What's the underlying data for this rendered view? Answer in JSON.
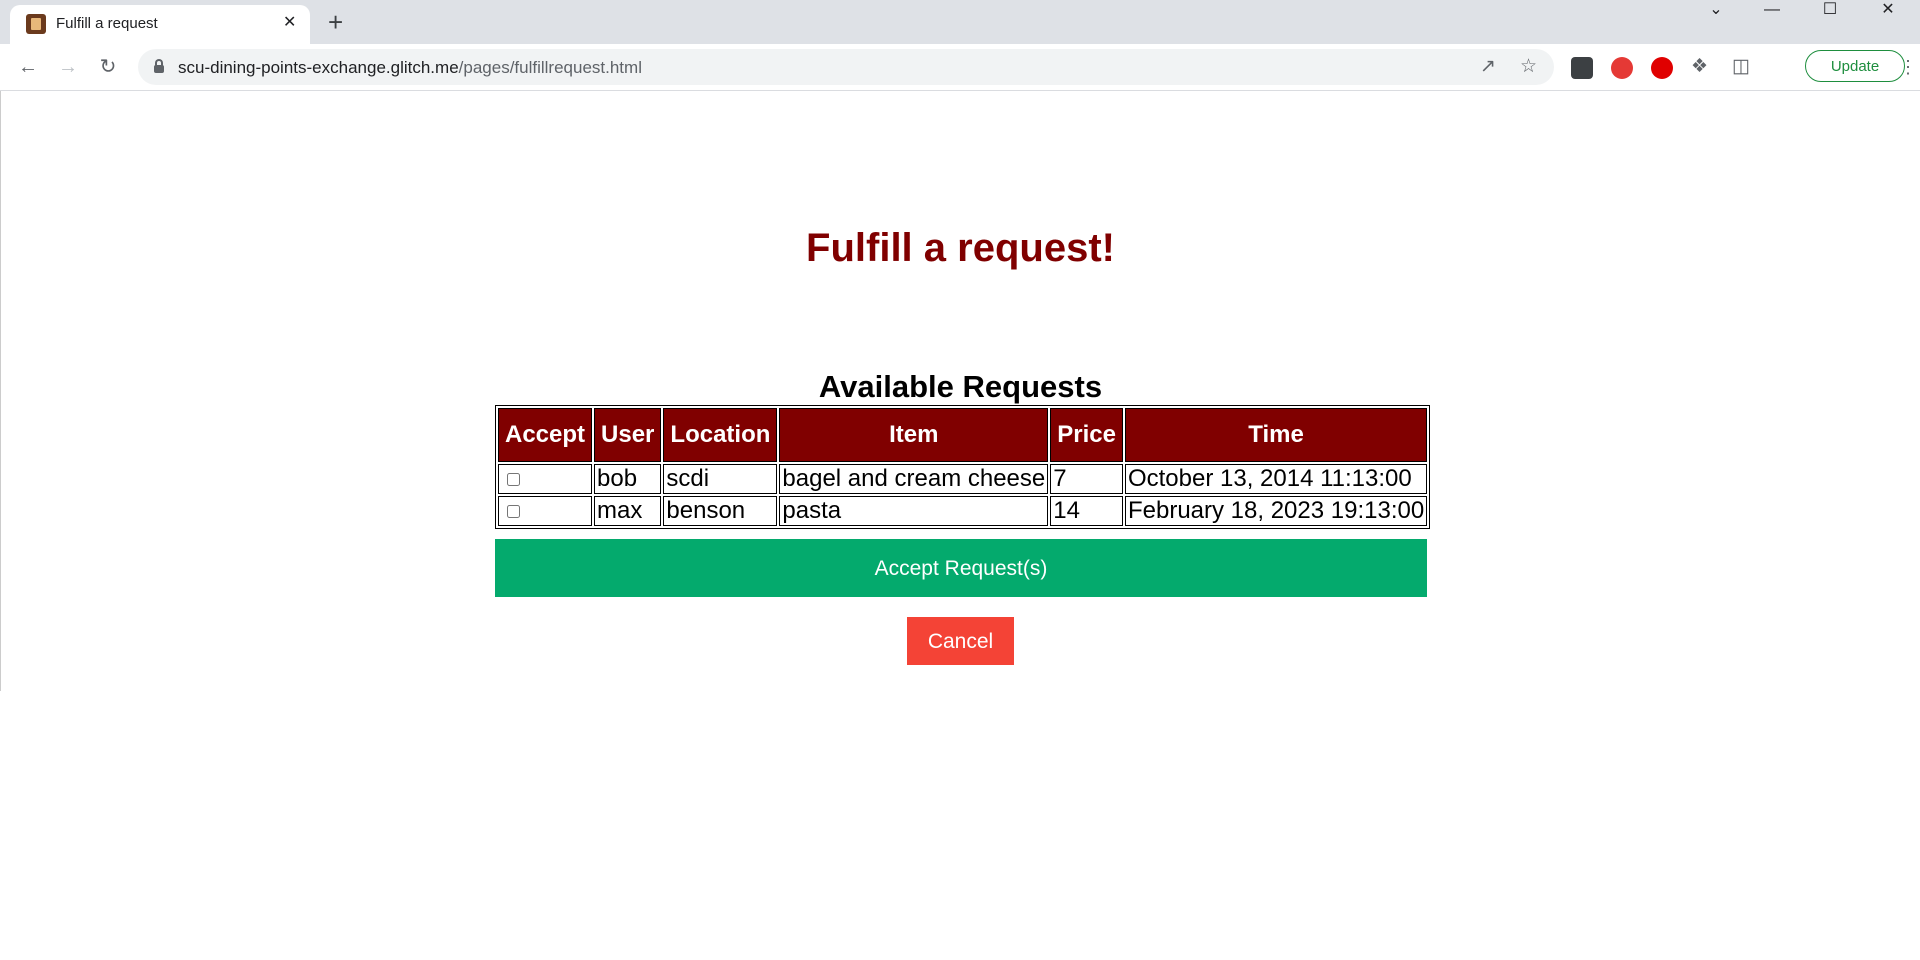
{
  "browser": {
    "tab_title": "Fulfill a request",
    "tab_close": "✕",
    "new_tab": "+",
    "url_host": "scu-dining-points-exchange.glitch.me",
    "url_path": "/pages/fulfillrequest.html",
    "update_label": "Update",
    "icons": [
      "back-icon",
      "forward-icon",
      "reload-icon",
      "lock-icon",
      "share-icon",
      "bookmark-star-icon",
      "extensions-icon",
      "side-panel-icon",
      "menu-icon"
    ],
    "window_controls": [
      "⌄",
      "—",
      "☐",
      "✕"
    ]
  },
  "page": {
    "title": "Fulfill a request!",
    "table_caption": "Available Requests",
    "columns": [
      "Accept",
      "User",
      "Location",
      "Item",
      "Price",
      "Time"
    ],
    "rows": [
      {
        "user": "bob",
        "location": "scdi",
        "item": "bagel and cream cheese",
        "price": "7",
        "time": "October 13, 2014 11:13:00",
        "checked": false
      },
      {
        "user": "max",
        "location": "benson",
        "item": "pasta",
        "price": "14",
        "time": "February 18, 2023 19:13:00",
        "checked": false
      }
    ],
    "accept_label": "Accept Request(s)",
    "cancel_label": "Cancel"
  },
  "colors": {
    "header_bg": "#800000",
    "title": "#800000",
    "accept_button": "#04aa6d",
    "cancel_button": "#f44336"
  }
}
